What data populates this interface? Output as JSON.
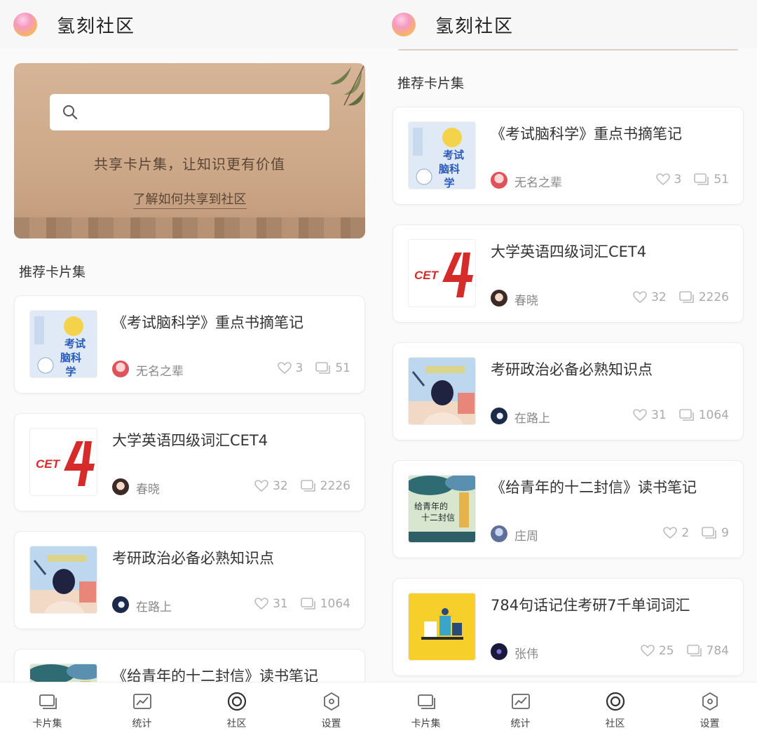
{
  "app": {
    "title": "氢刻社区"
  },
  "banner": {
    "search_placeholder": "",
    "slogan": "共享卡片集，让知识更有价值",
    "link": "了解如何共享到社区"
  },
  "section_title": "推荐卡片集",
  "cards": [
    {
      "title": "《考试脑科学》重点书摘笔记",
      "author": "无名之辈",
      "likes": "3",
      "comments": "51"
    },
    {
      "title": "大学英语四级词汇CET4",
      "author": "春晓",
      "likes": "32",
      "comments": "2226"
    },
    {
      "title": "考研政治必备必熟知识点",
      "author": "在路上",
      "likes": "31",
      "comments": "1064"
    },
    {
      "title": "《给青年的十二封信》读书笔记",
      "author": "庄周",
      "likes": "2",
      "comments": "9"
    },
    {
      "title": "784句话记住考研7千单词词汇",
      "author": "张伟",
      "likes": "25",
      "comments": "784"
    }
  ],
  "covers": {
    "c0_text": "考试脑科学",
    "c1_text": "CET4",
    "c3_text": "给青年的十二封信"
  },
  "tabs": [
    {
      "label": "卡片集",
      "icon": "cards-icon"
    },
    {
      "label": "统计",
      "icon": "chart-icon"
    },
    {
      "label": "社区",
      "icon": "community-icon"
    },
    {
      "label": "设置",
      "icon": "settings-icon"
    }
  ],
  "colors": {
    "accent": "#d62b2b",
    "banner": "#cfa98a",
    "muted": "#aaaaaa"
  }
}
